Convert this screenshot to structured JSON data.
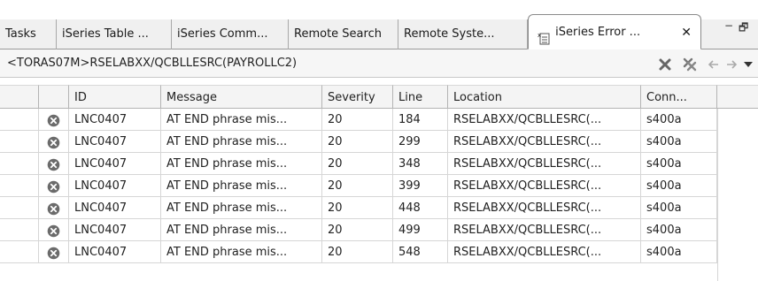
{
  "tabs": [
    {
      "label": "Tasks"
    },
    {
      "label": "iSeries Table ..."
    },
    {
      "label": "iSeries Comm..."
    },
    {
      "label": "Remote Search"
    },
    {
      "label": "Remote Syste..."
    },
    {
      "label": "iSeries Error ...",
      "active": true,
      "icon": "error-list-icon"
    }
  ],
  "window_controls": {
    "minimize": "−",
    "maximize": "🗗"
  },
  "path": "<TORAS07M>RSELABXX/QCBLLESRC(PAYROLLC2)",
  "toolbar": [
    {
      "icon": "remove-icon"
    },
    {
      "icon": "remove-all-icon"
    },
    {
      "icon": "back-arrow-icon"
    },
    {
      "icon": "forward-arrow-icon"
    },
    {
      "icon": "view-menu-icon"
    }
  ],
  "table": {
    "columns": [
      "",
      "",
      "ID",
      "Message",
      "Severity",
      "Line",
      "Location",
      "Conn..."
    ],
    "rows": [
      {
        "id": "LNC0407",
        "message": "AT END phrase mis...",
        "severity": "20",
        "line": "184",
        "location": "RSELABXX/QCBLLESRC(...",
        "conn": "s400a"
      },
      {
        "id": "LNC0407",
        "message": "AT END phrase mis...",
        "severity": "20",
        "line": "299",
        "location": "RSELABXX/QCBLLESRC(...",
        "conn": "s400a"
      },
      {
        "id": "LNC0407",
        "message": "AT END phrase mis...",
        "severity": "20",
        "line": "348",
        "location": "RSELABXX/QCBLLESRC(...",
        "conn": "s400a"
      },
      {
        "id": "LNC0407",
        "message": "AT END phrase mis...",
        "severity": "20",
        "line": "399",
        "location": "RSELABXX/QCBLLESRC(...",
        "conn": "s400a"
      },
      {
        "id": "LNC0407",
        "message": "AT END phrase mis...",
        "severity": "20",
        "line": "448",
        "location": "RSELABXX/QCBLLESRC(...",
        "conn": "s400a"
      },
      {
        "id": "LNC0407",
        "message": "AT END phrase mis...",
        "severity": "20",
        "line": "499",
        "location": "RSELABXX/QCBLLESRC(...",
        "conn": "s400a"
      },
      {
        "id": "LNC0407",
        "message": "AT END phrase mis...",
        "severity": "20",
        "line": "548",
        "location": "RSELABXX/QCBLLESRC(...",
        "conn": "s400a"
      }
    ]
  }
}
